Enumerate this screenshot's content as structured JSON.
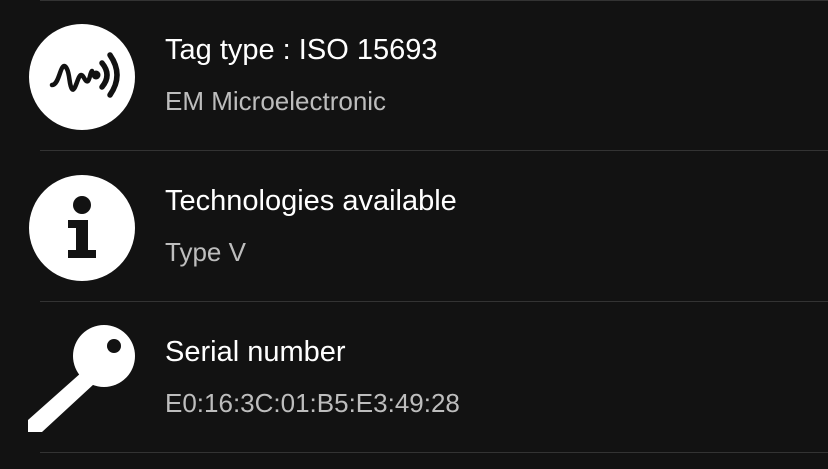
{
  "rows": [
    {
      "icon": "nfc-tag-icon",
      "title": "Tag type : ISO 15693",
      "subtitle": "EM Microelectronic"
    },
    {
      "icon": "info-icon",
      "title": "Technologies available",
      "subtitle": "Type V"
    },
    {
      "icon": "key-icon",
      "title": "Serial number",
      "subtitle": "E0:16:3C:01:B5:E3:49:28"
    }
  ],
  "colors": {
    "background": "#121212",
    "text_primary": "#ffffff",
    "text_secondary": "#bdbdbd",
    "divider": "#333333"
  }
}
